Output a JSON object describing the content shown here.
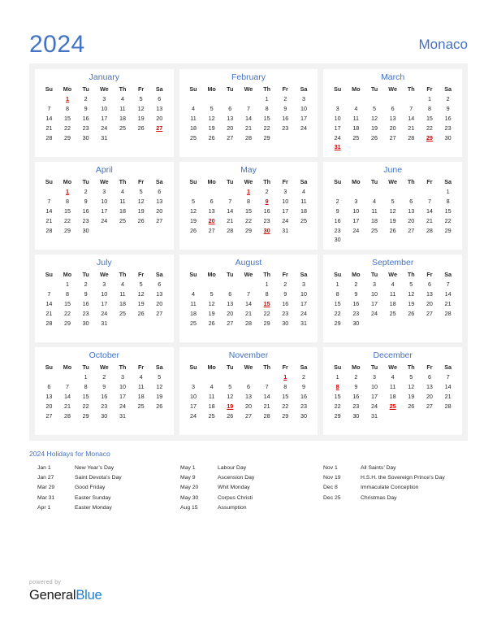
{
  "header": {
    "year": "2024",
    "country": "Monaco"
  },
  "weekday_headers": [
    "Su",
    "Mo",
    "Tu",
    "We",
    "Th",
    "Fr",
    "Sa"
  ],
  "colors": {
    "accent": "#4472c4",
    "holiday": "#d40000",
    "panel_bg": "#f2f2f2",
    "card_bg": "#ffffff",
    "logo_blue": "#1b7fd4"
  },
  "months": [
    {
      "name": "January",
      "first_weekday": 1,
      "days_in_month": 31,
      "holidays": [
        1,
        27
      ]
    },
    {
      "name": "February",
      "first_weekday": 4,
      "days_in_month": 29,
      "holidays": []
    },
    {
      "name": "March",
      "first_weekday": 5,
      "days_in_month": 31,
      "holidays": [
        29,
        31
      ]
    },
    {
      "name": "April",
      "first_weekday": 1,
      "days_in_month": 30,
      "holidays": [
        1
      ]
    },
    {
      "name": "May",
      "first_weekday": 3,
      "days_in_month": 31,
      "holidays": [
        1,
        9,
        20,
        30
      ]
    },
    {
      "name": "June",
      "first_weekday": 6,
      "days_in_month": 30,
      "holidays": []
    },
    {
      "name": "July",
      "first_weekday": 1,
      "days_in_month": 31,
      "holidays": []
    },
    {
      "name": "August",
      "first_weekday": 4,
      "days_in_month": 31,
      "holidays": [
        15
      ]
    },
    {
      "name": "September",
      "first_weekday": 0,
      "days_in_month": 30,
      "holidays": []
    },
    {
      "name": "October",
      "first_weekday": 2,
      "days_in_month": 31,
      "holidays": []
    },
    {
      "name": "November",
      "first_weekday": 5,
      "days_in_month": 30,
      "holidays": [
        1,
        19
      ]
    },
    {
      "name": "December",
      "first_weekday": 0,
      "days_in_month": 31,
      "holidays": [
        8,
        25
      ]
    }
  ],
  "legend": {
    "title": "2024 Holidays for Monaco",
    "columns": [
      [
        {
          "date": "Jan 1",
          "name": "New Year’s Day"
        },
        {
          "date": "Jan 27",
          "name": "Saint Devota’s Day"
        },
        {
          "date": "Mar 29",
          "name": "Good Friday"
        },
        {
          "date": "Mar 31",
          "name": "Easter Sunday"
        },
        {
          "date": "Apr 1",
          "name": "Easter Monday"
        }
      ],
      [
        {
          "date": "May 1",
          "name": "Labour Day"
        },
        {
          "date": "May 9",
          "name": "Ascension Day"
        },
        {
          "date": "May 20",
          "name": "Whit Monday"
        },
        {
          "date": "May 30",
          "name": "Corpus Christi"
        },
        {
          "date": "Aug 15",
          "name": "Assumption"
        }
      ],
      [
        {
          "date": "Nov 1",
          "name": "All Saints’ Day"
        },
        {
          "date": "Nov 19",
          "name": "H.S.H. the Sovereign Prince’s Day"
        },
        {
          "date": "Dec 8",
          "name": "Immaculate Conception"
        },
        {
          "date": "Dec 25",
          "name": "Christmas Day"
        }
      ]
    ]
  },
  "footer": {
    "powered_by": "powered by",
    "logo_first": "General",
    "logo_second": "Blue"
  }
}
